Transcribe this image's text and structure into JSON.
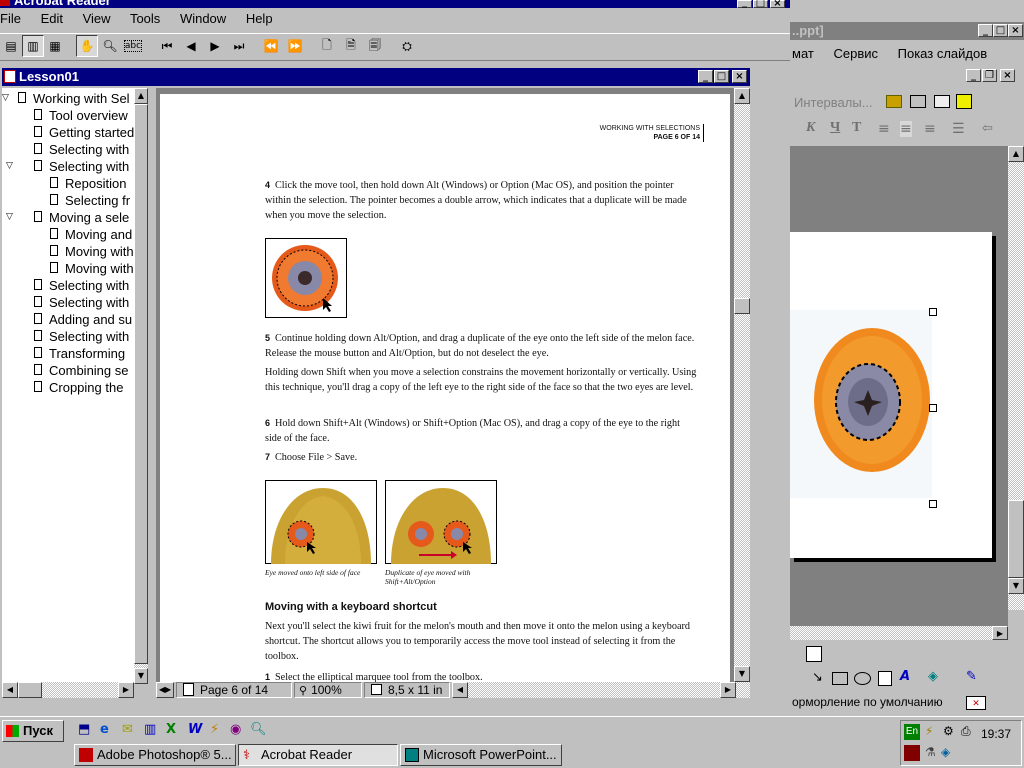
{
  "acrobat": {
    "title": "Acrobat Reader",
    "menu": [
      "File",
      "Edit",
      "View",
      "Tools",
      "Window",
      "Help"
    ],
    "doc_title": "Lesson01",
    "bookmarks": [
      {
        "label": "Working with Sel",
        "level": 0,
        "expand": true
      },
      {
        "label": "Tool overview",
        "level": 1
      },
      {
        "label": "Getting started",
        "level": 1
      },
      {
        "label": "Selecting with",
        "level": 1
      },
      {
        "label": "Selecting with",
        "level": 1,
        "expand": true
      },
      {
        "label": "Reposition",
        "level": 2
      },
      {
        "label": "Selecting fr",
        "level": 2
      },
      {
        "label": "Moving a sele",
        "level": 1,
        "expand": true
      },
      {
        "label": "Moving and",
        "level": 2
      },
      {
        "label": "Moving with",
        "level": 2
      },
      {
        "label": "Moving with",
        "level": 2
      },
      {
        "label": "Selecting with",
        "level": 1
      },
      {
        "label": "Selecting with",
        "level": 1
      },
      {
        "label": "Adding and su",
        "level": 1
      },
      {
        "label": "Selecting with",
        "level": 1
      },
      {
        "label": "Transforming",
        "level": 1
      },
      {
        "label": "Combining se",
        "level": 1
      },
      {
        "label": "Cropping the",
        "level": 1
      }
    ],
    "page": {
      "header_line1": "WORKING WITH SELECTIONS",
      "header_line2": "PAGE 6 OF 14",
      "step4_num": "4",
      "step4": "Click the move tool, then hold down Alt (Windows) or Option (Mac OS), and position the pointer within the selection. The pointer becomes a double arrow, which indicates that a duplicate will be made when you move the selection.",
      "step5_num": "5",
      "step5": "Continue holding down Alt/Option, and drag a duplicate of the eye onto the left side of the melon face. Release the mouse button and Alt/Option, but do not deselect the eye.",
      "shift_para": "Holding down Shift when you move a selection constrains the movement horizontally or vertically. Using this technique, you'll drag a copy of the left eye to the right side of the face so that the two eyes are level.",
      "step6_num": "6",
      "step6": "Hold down Shift+Alt (Windows) or Shift+Option (Mac OS), and drag a copy of the eye to the right side of the face.",
      "step7_num": "7",
      "step7": "Choose File > Save.",
      "caption1": "Eye moved onto left side of face",
      "caption2": "Duplicate of eye moved with Shift+Alt/Option",
      "heading": "Moving with a keyboard shortcut",
      "kbd_para": "Next you'll select the kiwi fruit for the melon's mouth and then move it onto the melon using a keyboard shortcut. The shortcut allows you to temporarily access the move tool instead of selecting it from the toolbox.",
      "step1_num": "1",
      "step1": "Select the elliptical marquee tool from the toolbox."
    },
    "status": {
      "page": "Page 6 of 14",
      "zoom": "100%",
      "size": "8,5 x 11 in"
    }
  },
  "powerpoint": {
    "title": "..ppt]",
    "menu": [
      "мат",
      "Сервис",
      "Показ слайдов"
    ],
    "toolbar_text": "Интервалы...",
    "status": "орморление по умолчанию"
  },
  "taskbar": {
    "start": "Пуск",
    "tasks": [
      "Adobe Photoshop® 5...",
      "Acrobat Reader",
      "Microsoft PowerPoint..."
    ],
    "lang": "En",
    "clock": "19:37"
  }
}
